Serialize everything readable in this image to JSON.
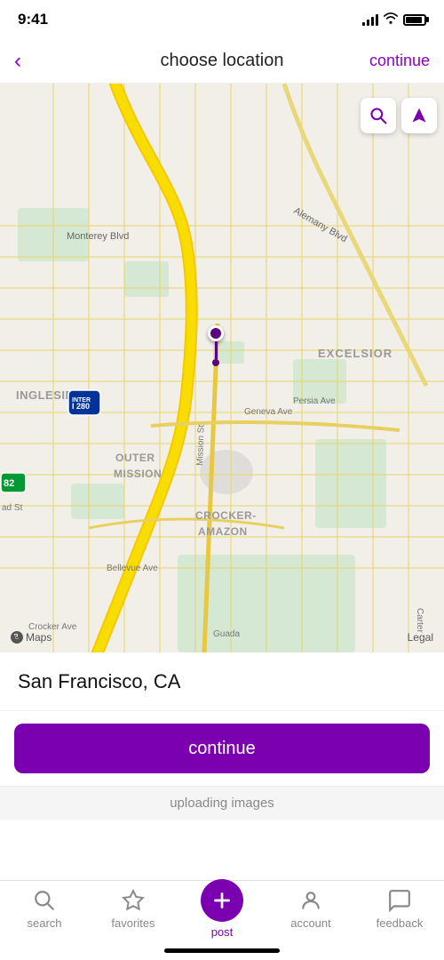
{
  "statusBar": {
    "time": "9:41",
    "signal": "4 bars",
    "wifi": "on",
    "battery": "full"
  },
  "header": {
    "back_label": "‹",
    "title": "choose location",
    "continue_label": "continue"
  },
  "map": {
    "search_icon": "search",
    "navigate_icon": "navigate",
    "apple_maps": "Maps",
    "legal": "Legal",
    "labels": {
      "monterey_blvd": "Monterey Blvd",
      "alemany_blvd": "Alemany Blvd",
      "excelsior": "EXCELSIOR",
      "persia_ave": "Persia Ave",
      "ingleside": "INGLESIDE",
      "outer_mission": "OUTER\nMISSION",
      "mission_st": "Mission St",
      "geneva_ave": "Geneva Ave",
      "crocker_amazon": "CROCKER-\nAMAZON",
      "bellevue_ave": "Bellevue Ave",
      "crocker_ave": "Crocker Ave",
      "guada": "Guada",
      "glad_st": "ad St",
      "carter": "Carter",
      "i280": "280",
      "i82": "82"
    }
  },
  "location": {
    "text": "San Francisco, CA"
  },
  "continueButton": {
    "label": "continue"
  },
  "uploadingStatus": {
    "text": "uploading images"
  },
  "tabBar": {
    "items": [
      {
        "id": "search",
        "label": "search",
        "icon": "search",
        "active": false
      },
      {
        "id": "favorites",
        "label": "favorites",
        "icon": "star",
        "active": false
      },
      {
        "id": "post",
        "label": "post",
        "icon": "plus",
        "active": true
      },
      {
        "id": "account",
        "label": "account",
        "icon": "person",
        "active": false
      },
      {
        "id": "feedback",
        "label": "feedback",
        "icon": "bubble",
        "active": false
      }
    ]
  }
}
